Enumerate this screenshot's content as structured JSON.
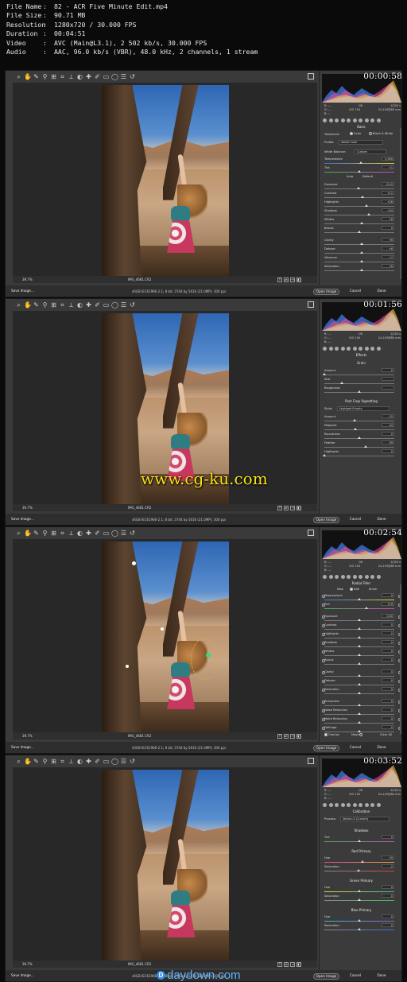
{
  "file_info": [
    {
      "label": "File Name",
      "value": "82 - ACR Five Minute Edit.mp4"
    },
    {
      "label": "File Size",
      "value": "90.71 MB"
    },
    {
      "label": "Resolution",
      "value": "1280x720 / 30.000 FPS"
    },
    {
      "label": "Duration",
      "value": "00:04:51"
    },
    {
      "label": "Video",
      "value": "AVC (Main@L3.1), 2 502 kb/s, 30.000 FPS"
    },
    {
      "label": "Audio",
      "value": "AAC, 96.0 kb/s (VBR), 48.0 kHz, 2 channels, 1 stream"
    }
  ],
  "separator": ":",
  "ui": {
    "zoom": "39.7%",
    "filename": "IMG_4681.CR2",
    "workflow": "sRGB IEC61966-2.1; 8 bit; 3744 by 5616 (21.0MP); 300 ppi",
    "save_label": "Save Image...",
    "open_label": "Open Image",
    "cancel_label": "Cancel",
    "done_label": "Done",
    "cam": {
      "r": "R: ---",
      "g": "G: ---",
      "b": "B: ---",
      "fstop": "f/8",
      "shutter": "1/320 s",
      "iso": "ISO 100",
      "lens": "24-105@80 mm"
    }
  },
  "frames": [
    {
      "time": "00:00:58",
      "title": "Basic",
      "treatment_label": "Treatment:",
      "color_opt": "Color",
      "bw_opt": "Black & White",
      "profile_label": "Profile:",
      "profile_value": "Adobe Color",
      "wb_label": "White Balance:",
      "wb_value": "Custom",
      "auto": "Auto",
      "default": "Default",
      "sliders": [
        {
          "label": "Temperature",
          "value": "5,900",
          "pos": 0.52
        },
        {
          "label": "Tint",
          "value": "+1",
          "pos": 0.5
        },
        {
          "label": "Exposure",
          "value": "-0.10",
          "pos": 0.49
        },
        {
          "label": "Contrast",
          "value": "+11",
          "pos": 0.55
        },
        {
          "label": "Highlights",
          "value": "+26",
          "pos": 0.6
        },
        {
          "label": "Shadows",
          "value": "+34",
          "pos": 0.64
        },
        {
          "label": "Whites",
          "value": "+8",
          "pos": 0.53
        },
        {
          "label": "Blacks",
          "value": "0",
          "pos": 0.5
        },
        {
          "label": "Clarity",
          "value": "+6",
          "pos": 0.53
        },
        {
          "label": "Dehaze",
          "value": "+6",
          "pos": 0.53
        },
        {
          "label": "Vibrance",
          "value": "+7",
          "pos": 0.53
        },
        {
          "label": "Saturation",
          "value": "+6",
          "pos": 0.53
        }
      ]
    },
    {
      "time": "00:01:56",
      "title": "Effects",
      "grain_title": "Grain",
      "vignette_title": "Post Crop Vignetting",
      "style_label": "Style:",
      "style_value": "Highlight Priority",
      "grain_sliders": [
        {
          "label": "Amount",
          "value": "0",
          "pos": 0.0
        },
        {
          "label": "Size",
          "value": "",
          "pos": 0.25
        },
        {
          "label": "Roughness",
          "value": "",
          "pos": 0.5
        }
      ],
      "vig_sliders": [
        {
          "label": "Amount",
          "value": "-15",
          "pos": 0.43
        },
        {
          "label": "Midpoint",
          "value": "44",
          "pos": 0.44
        },
        {
          "label": "Roundness",
          "value": "0",
          "pos": 0.5
        },
        {
          "label": "Feather",
          "value": "59",
          "pos": 0.59
        },
        {
          "label": "Highlights",
          "value": "0",
          "pos": 0.0
        }
      ],
      "watermark": "www.cg-ku.com"
    },
    {
      "time": "00:02:54",
      "title": "Radial Filter",
      "new_label": "New",
      "edit_label": "Edit",
      "brush_label": "Brush",
      "overlay_label": "Overlay",
      "mask_label": "Mask",
      "clear_label": "Clear All",
      "sliders": [
        {
          "label": "Temperature",
          "value": "0",
          "pos": 0.5
        },
        {
          "label": "Tint",
          "value": "+19",
          "pos": 0.6
        },
        {
          "label": "Exposure",
          "value": "0.00",
          "pos": 0.5
        },
        {
          "label": "Contrast",
          "value": "0",
          "pos": 0.5
        },
        {
          "label": "Highlights",
          "value": "0",
          "pos": 0.5
        },
        {
          "label": "Shadows",
          "value": "0",
          "pos": 0.5
        },
        {
          "label": "Whites",
          "value": "0",
          "pos": 0.5
        },
        {
          "label": "Blacks",
          "value": "0",
          "pos": 0.5
        },
        {
          "label": "Clarity",
          "value": "0",
          "pos": 0.5
        },
        {
          "label": "Dehaze",
          "value": "0",
          "pos": 0.5
        },
        {
          "label": "Saturation",
          "value": "0",
          "pos": 0.5
        },
        {
          "label": "Sharpness",
          "value": "0",
          "pos": 0.5
        },
        {
          "label": "Noise Reduction",
          "value": "0",
          "pos": 0.5
        },
        {
          "label": "Moire Reduction",
          "value": "0",
          "pos": 0.5
        },
        {
          "label": "Defringe",
          "value": "0",
          "pos": 0.5
        }
      ]
    },
    {
      "time": "00:03:52",
      "title": "Calibration",
      "process_label": "Process:",
      "process_value": "Version 4 (Current)",
      "groups": [
        {
          "title": "Shadows",
          "sliders": [
            {
              "label": "Tint",
              "value": "0",
              "pos": 0.5
            }
          ]
        },
        {
          "title": "Red Primary",
          "sliders": [
            {
              "label": "Hue",
              "value": "+9",
              "pos": 0.55
            },
            {
              "label": "Saturation",
              "value": "-2",
              "pos": 0.49
            }
          ]
        },
        {
          "title": "Green Primary",
          "sliders": [
            {
              "label": "Hue",
              "value": "0",
              "pos": 0.5
            },
            {
              "label": "Saturation",
              "value": "0",
              "pos": 0.5
            }
          ]
        },
        {
          "title": "Blue Primary",
          "sliders": [
            {
              "label": "Hue",
              "value": "0",
              "pos": 0.5
            },
            {
              "label": "Saturation",
              "value": "0",
              "pos": 0.5
            }
          ]
        }
      ],
      "watermark": "daydown.com",
      "watermark_icon": "D"
    }
  ]
}
